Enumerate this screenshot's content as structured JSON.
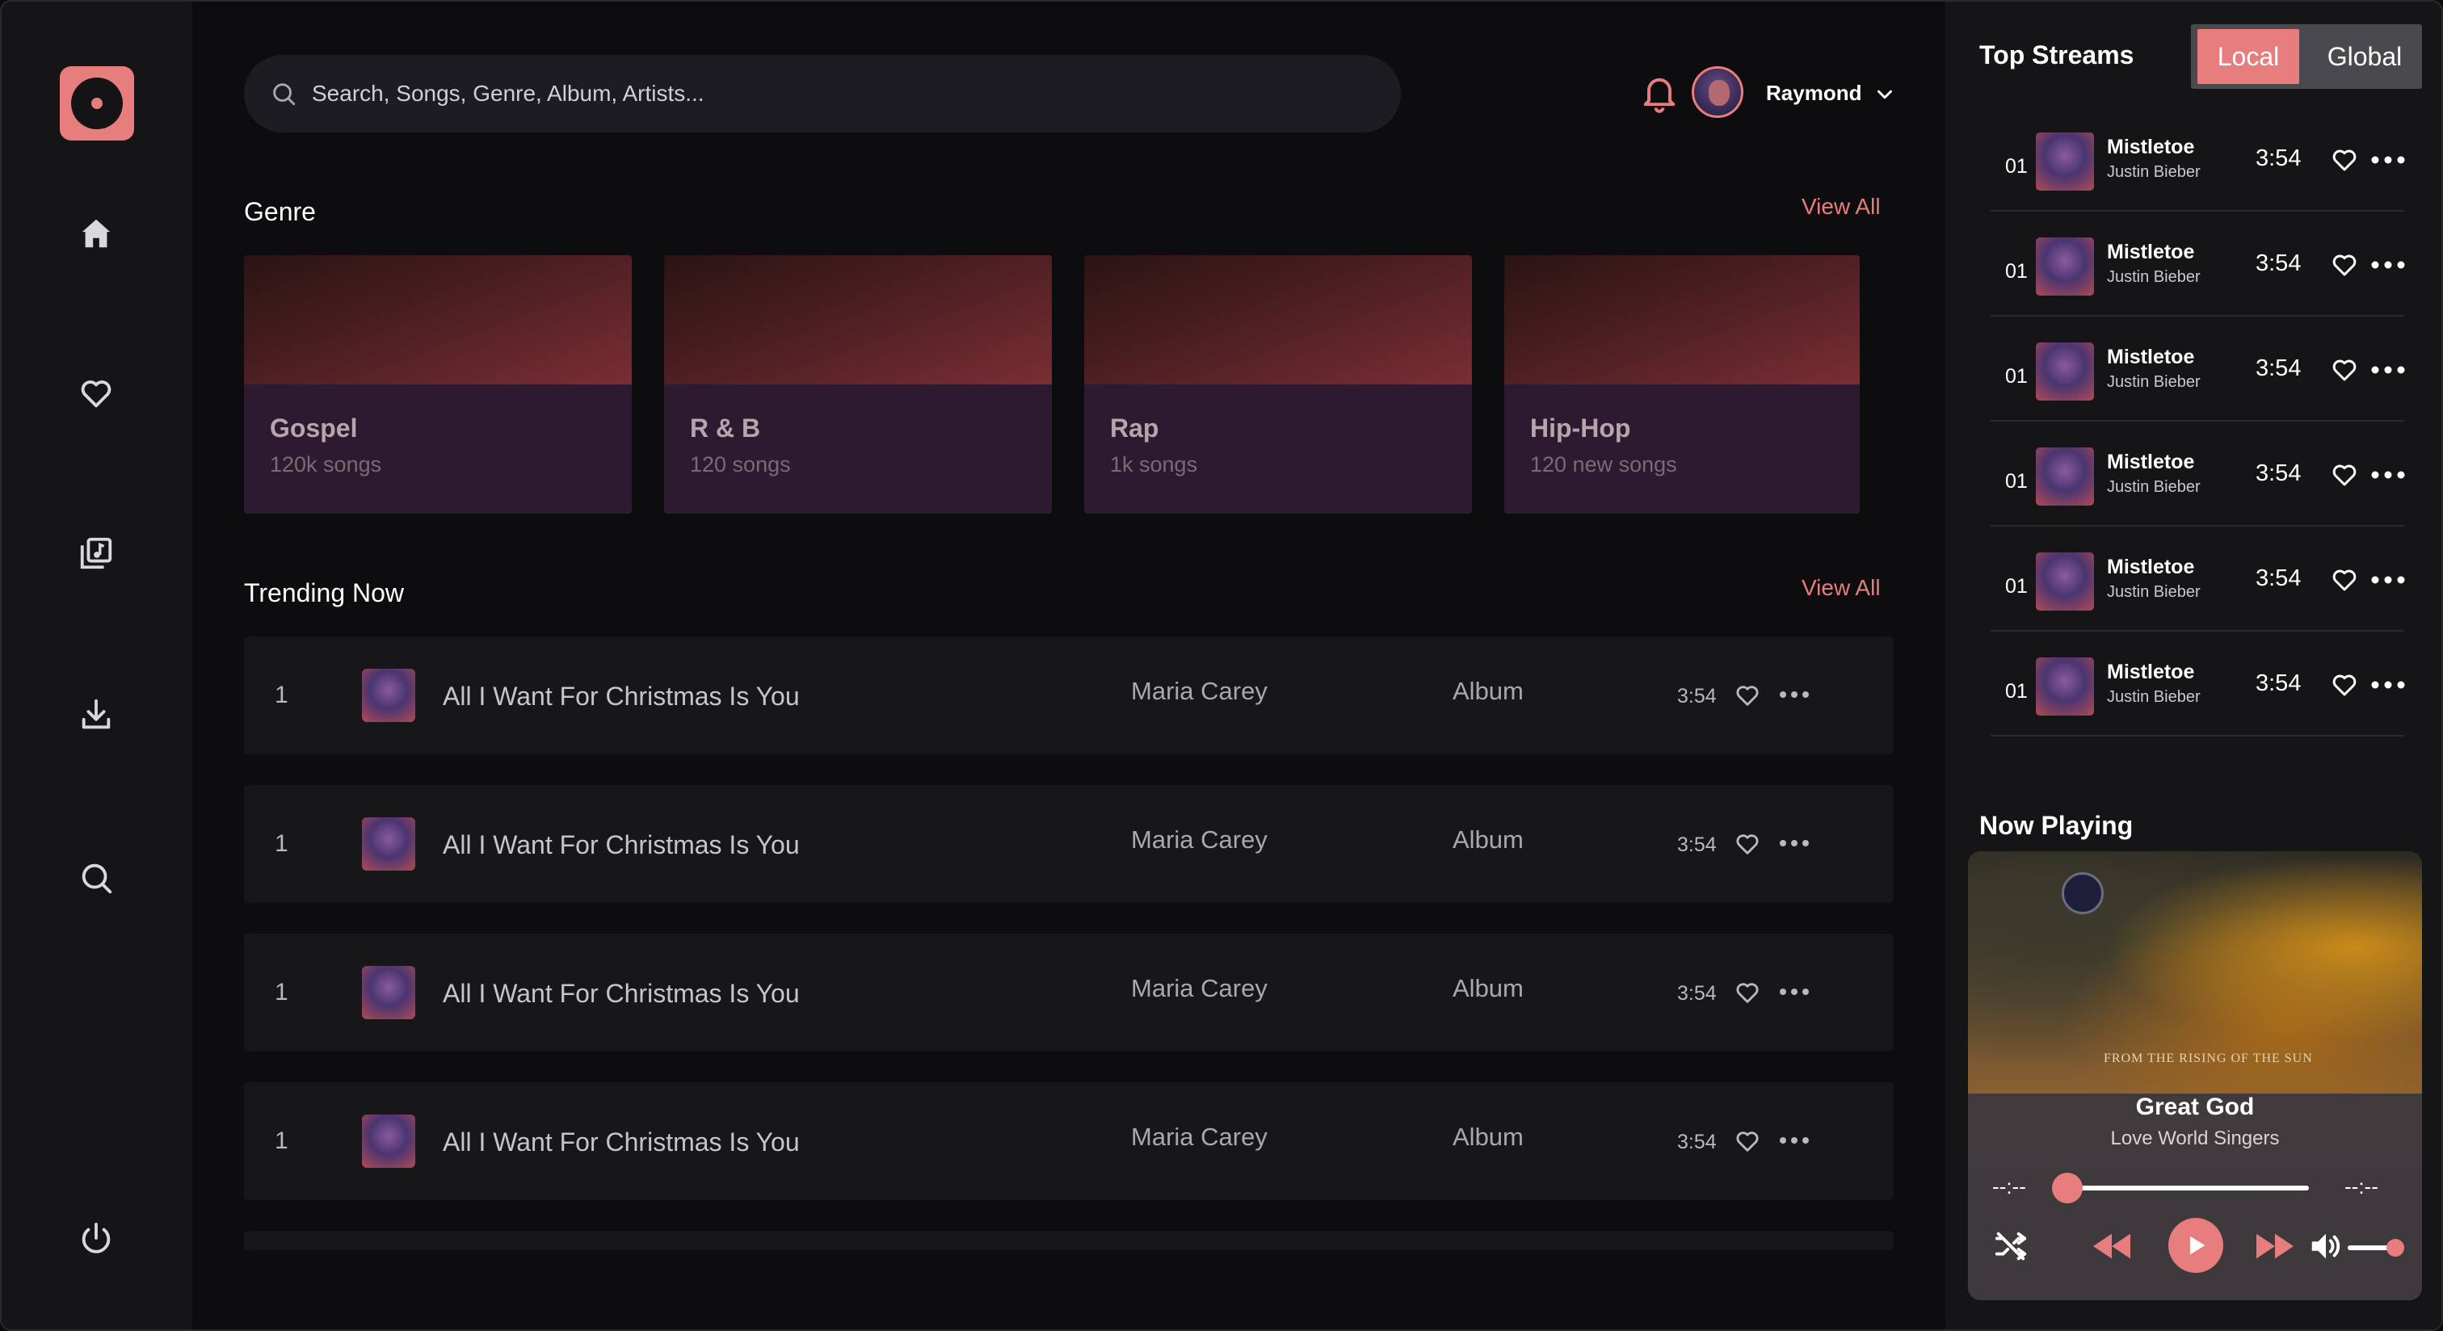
{
  "colors": {
    "accent": "#e77e7d",
    "background": "#0d0d10",
    "sidebar": "#151518"
  },
  "sidebar": {
    "items": [
      {
        "name": "home",
        "icon": "home-icon"
      },
      {
        "name": "favorites",
        "icon": "heart-icon"
      },
      {
        "name": "library",
        "icon": "music-library-icon"
      },
      {
        "name": "downloads",
        "icon": "download-icon"
      },
      {
        "name": "search",
        "icon": "search-icon"
      }
    ],
    "logout_icon": "power-icon"
  },
  "header": {
    "search_placeholder": "Search, Songs, Genre, Album, Artists...",
    "username": "Raymond"
  },
  "genre": {
    "title": "Genre",
    "view_all": "View All",
    "cards": [
      {
        "name": "Gospel",
        "count": "120k songs"
      },
      {
        "name": "R & B",
        "count": "120 songs"
      },
      {
        "name": "Rap",
        "count": "1k songs"
      },
      {
        "name": "Hip-Hop",
        "count": "120 new songs"
      }
    ]
  },
  "trending": {
    "title": "Trending Now",
    "view_all": "View All",
    "rows": [
      {
        "num": "1",
        "song": "All I Want For Christmas Is You",
        "artist": "Maria Carey",
        "album": "Album",
        "duration": "3:54"
      },
      {
        "num": "1",
        "song": "All I Want For Christmas Is You",
        "artist": "Maria Carey",
        "album": "Album",
        "duration": "3:54"
      },
      {
        "num": "1",
        "song": "All I Want For Christmas Is You",
        "artist": "Maria Carey",
        "album": "Album",
        "duration": "3:54"
      },
      {
        "num": "1",
        "song": "All I Want For Christmas Is You",
        "artist": "Maria Carey",
        "album": "Album",
        "duration": "3:54"
      }
    ]
  },
  "top_streams": {
    "title": "Top Streams",
    "tabs": {
      "local": "Local",
      "global": "Global"
    },
    "items": [
      {
        "rank": "01",
        "name": "Mistletoe",
        "artist": "Justin Bieber",
        "duration": "3:54"
      },
      {
        "rank": "01",
        "name": "Mistletoe",
        "artist": "Justin Bieber",
        "duration": "3:54"
      },
      {
        "rank": "01",
        "name": "Mistletoe",
        "artist": "Justin Bieber",
        "duration": "3:54"
      },
      {
        "rank": "01",
        "name": "Mistletoe",
        "artist": "Justin Bieber",
        "duration": "3:54"
      },
      {
        "rank": "01",
        "name": "Mistletoe",
        "artist": "Justin Bieber",
        "duration": "3:54"
      },
      {
        "rank": "01",
        "name": "Mistletoe",
        "artist": "Justin Bieber",
        "duration": "3:54"
      }
    ]
  },
  "now_playing": {
    "title": "Now Playing",
    "song": "Great God",
    "artist": "Love World Singers",
    "cover_text": "FROM THE RISING OF THE SUN",
    "time_elapsed": "--:--",
    "time_total": "--:--"
  }
}
